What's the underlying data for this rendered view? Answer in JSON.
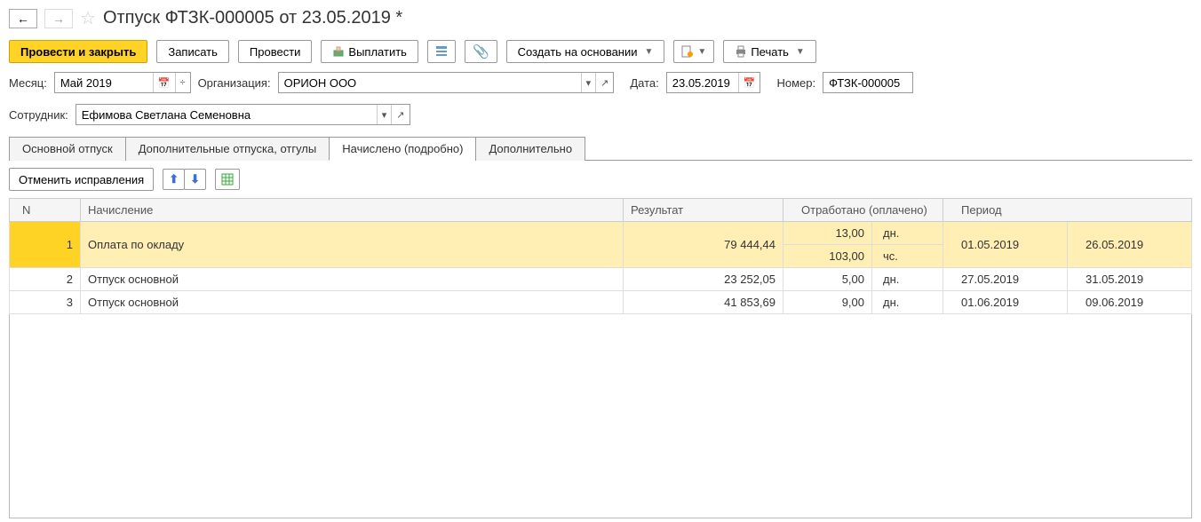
{
  "title": "Отпуск ФТЗК-000005 от 23.05.2019 *",
  "toolbar": {
    "post_and_close": "Провести и закрыть",
    "save": "Записать",
    "post": "Провести",
    "payout": "Выплатить",
    "create_based": "Создать на основании",
    "print": "Печать"
  },
  "fields": {
    "month_label": "Месяц:",
    "month_value": "Май 2019",
    "org_label": "Организация:",
    "org_value": "ОРИОН ООО",
    "date_label": "Дата:",
    "date_value": "23.05.2019",
    "number_label": "Номер:",
    "number_value": "ФТЗК-000005",
    "employee_label": "Сотрудник:",
    "employee_value": "Ефимова Светлана Семеновна"
  },
  "tabs": [
    {
      "label": "Основной отпуск",
      "active": false
    },
    {
      "label": "Дополнительные отпуска, отгулы",
      "active": false
    },
    {
      "label": "Начислено (подробно)",
      "active": true
    },
    {
      "label": "Дополнительно",
      "active": false
    }
  ],
  "subtoolbar": {
    "cancel_corrections": "Отменить исправления"
  },
  "grid": {
    "headers": {
      "n": "N",
      "accrual": "Начисление",
      "result": "Результат",
      "worked": "Отработано (оплачено)",
      "period": "Период"
    },
    "rows": [
      {
        "n": "1",
        "accrual": "Оплата по окладу",
        "result": "79 444,44",
        "worked": [
          {
            "val": "13,00",
            "unit": "дн."
          },
          {
            "val": "103,00",
            "unit": "чс."
          }
        ],
        "period_from": "01.05.2019",
        "period_to": "26.05.2019",
        "selected": true
      },
      {
        "n": "2",
        "accrual": "Отпуск основной",
        "result": "23 252,05",
        "worked": [
          {
            "val": "5,00",
            "unit": "дн."
          }
        ],
        "period_from": "27.05.2019",
        "period_to": "31.05.2019",
        "selected": false
      },
      {
        "n": "3",
        "accrual": "Отпуск основной",
        "result": "41 853,69",
        "worked": [
          {
            "val": "9,00",
            "unit": "дн."
          }
        ],
        "period_from": "01.06.2019",
        "period_to": "09.06.2019",
        "selected": false
      }
    ]
  }
}
